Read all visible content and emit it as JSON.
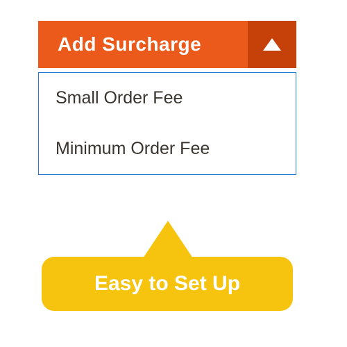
{
  "dropdown": {
    "button_label": "Add Surcharge",
    "items": [
      {
        "label": "Small Order Fee"
      },
      {
        "label": "Minimum Order Fee"
      }
    ]
  },
  "callout": {
    "text": "Easy to Set Up"
  },
  "colors": {
    "button_bg": "#eb5a1a",
    "button_arrow_bg": "#c6410a",
    "menu_border": "#1f7bd8",
    "callout_bg": "#f6c40f"
  }
}
